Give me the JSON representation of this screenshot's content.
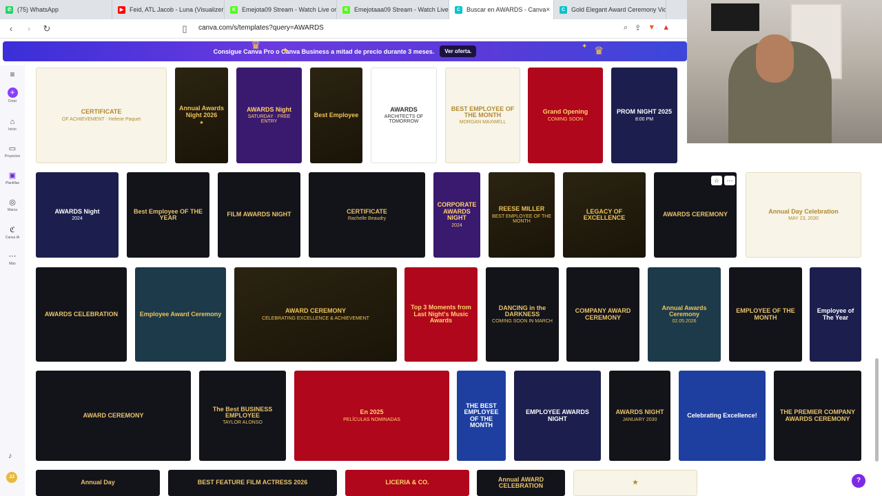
{
  "tabs": [
    {
      "label": "(75) WhatsApp",
      "color": "#25d366",
      "icon": "whatsapp-icon",
      "glyph": "✆"
    },
    {
      "label": "Feid, ATL Jacob - Luna (Visualizer) - Y",
      "color": "#ff0000",
      "icon": "youtube-icon",
      "glyph": "▶"
    },
    {
      "label": "Emejota09 Stream - Watch Live on K",
      "color": "#53fc18",
      "icon": "kick-icon",
      "glyph": "K"
    },
    {
      "label": "Emejotaaa09 Stream - Watch Live on",
      "color": "#53fc18",
      "icon": "kick-icon",
      "glyph": "K"
    },
    {
      "label": "Buscar en AWARDS - Canva",
      "color": "#00c4cc",
      "icon": "canva-icon",
      "glyph": "C",
      "active": true
    },
    {
      "label": "Gold Elegant Award Ceremony Vide",
      "color": "#00c4cc",
      "icon": "canva-icon",
      "glyph": "C"
    }
  ],
  "address": {
    "url": "canva.com/s/templates?query=AWARDS"
  },
  "promo": {
    "text": "Consigue Canva Pro o Canva Business a mitad de precio durante 3 meses.",
    "button": "Ver oferta."
  },
  "sidebar": [
    {
      "label": "Crear",
      "icon": "plus-icon",
      "glyph": "+"
    },
    {
      "label": "Inicio",
      "icon": "home-icon",
      "glyph": "⌂"
    },
    {
      "label": "Proyectos",
      "icon": "folder-icon",
      "glyph": "▭"
    },
    {
      "label": "Plantillas",
      "icon": "templates-icon",
      "glyph": "▣"
    },
    {
      "label": "Marca",
      "icon": "brand-icon",
      "glyph": "◎"
    },
    {
      "label": "Canva IA",
      "icon": "ai-icon",
      "glyph": "ℭ"
    },
    {
      "label": "Más",
      "icon": "more-icon",
      "glyph": "⋯"
    }
  ],
  "avatar": "JJ",
  "templates": [
    {
      "t1": "CERTIFICATE",
      "t2": "OF ACHIEVEMENT · Helene Paquet",
      "style": "light"
    },
    {
      "t1": "Annual Awards Night 2026",
      "t2": "★",
      "style": "gold"
    },
    {
      "t1": "AWARDS Night",
      "t2": "SATURDAY · FREE ENTRY",
      "style": "purple"
    },
    {
      "t1": "Best Employee",
      "t2": "",
      "style": "gold"
    },
    {
      "t1": "AWARDS",
      "t2": "ARCHITECTS OF TOMORROW",
      "style": "whitec"
    },
    {
      "t1": "BEST EMPLOYEE OF THE MONTH",
      "t2": "MORGAN MAXWELL",
      "style": "light"
    },
    {
      "t1": "Grand Opening",
      "t2": "COMING SOON",
      "style": "red"
    },
    {
      "t1": "PROM NIGHT 2025",
      "t2": "8:00 PM",
      "style": "navy"
    },
    {
      "t1": "AWARDS Night",
      "t2": "2024",
      "style": "navy"
    },
    {
      "t1": "Best Employee OF THE YEAR",
      "t2": "",
      "style": "dark"
    },
    {
      "t1": "FILM AWARDS NIGHT",
      "t2": "",
      "style": "dark"
    },
    {
      "t1": "CERTIFICATE",
      "t2": "Rachelle Beaudry",
      "style": "dark"
    },
    {
      "t1": "CORPORATE AWARDS NIGHT",
      "t2": "2024",
      "style": "purple"
    },
    {
      "t1": "REESE MILLER",
      "t2": "BEST EMPLOYEE OF THE MONTH",
      "style": "gold"
    },
    {
      "t1": "LEGACY OF EXCELLENCE",
      "t2": "",
      "style": "gold"
    },
    {
      "t1": "AWARDS CEREMONY",
      "t2": "",
      "style": "dark"
    },
    {
      "t1": "Annual Day Celebration",
      "t2": "MAY 23, 2030",
      "style": "light"
    },
    {
      "t1": "AWARDS CELEBRATION",
      "t2": "",
      "style": "dark"
    },
    {
      "t1": "Employee Award Ceremony",
      "t2": "",
      "style": "teal"
    },
    {
      "t1": "AWARD CEREMONY",
      "t2": "CELEBRATING EXCELLENCE & ACHIEVEMENT",
      "style": "gold"
    },
    {
      "t1": "Top 3 Moments from Last Night's Music Awards",
      "t2": "",
      "style": "red"
    },
    {
      "t1": "DANCING in the DARKNESS",
      "t2": "COMING SOON IN MARCH",
      "style": "dark"
    },
    {
      "t1": "COMPANY AWARD CEREMONY",
      "t2": "",
      "style": "dark"
    },
    {
      "t1": "Annual Awards Ceremony",
      "t2": "02.05.2026",
      "style": "teal"
    },
    {
      "t1": "EMPLOYEE OF THE MONTH",
      "t2": "",
      "style": "dark"
    },
    {
      "t1": "Employee of The Year",
      "t2": "",
      "style": "navy"
    },
    {
      "t1": "AWARD CEREMONY",
      "t2": "",
      "style": "dark"
    },
    {
      "t1": "The Best BUSINESS EMPLOYEE",
      "t2": "TAYLOR ALONSO",
      "style": "dark"
    },
    {
      "t1": "En 2025",
      "t2": "PELÍCULAS NOMINADAS",
      "style": "red"
    },
    {
      "t1": "THE BEST EMPLOYEE OF THE MONTH",
      "t2": "",
      "style": "blue"
    },
    {
      "t1": "EMPLOYEE AWARDS NIGHT",
      "t2": "",
      "style": "navy"
    },
    {
      "t1": "AWARDS NIGHT",
      "t2": "JANUARY 2030",
      "style": "dark"
    },
    {
      "t1": "Celebrating Excellence!",
      "t2": "",
      "style": "blue"
    },
    {
      "t1": "THE PREMIER COMPANY AWARDS CEREMONY",
      "t2": "",
      "style": "dark"
    },
    {
      "t1": "Annual Day",
      "t2": "",
      "style": "dark"
    },
    {
      "t1": "BEST FEATURE FILM ACTRESS 2026",
      "t2": "",
      "style": "dark"
    },
    {
      "t1": "LICERIA & CO.",
      "t2": "",
      "style": "red"
    },
    {
      "t1": "Annual AWARD CELEBRATION",
      "t2": "",
      "style": "dark"
    },
    {
      "t1": "★",
      "t2": "",
      "style": "light"
    }
  ],
  "help": "?"
}
